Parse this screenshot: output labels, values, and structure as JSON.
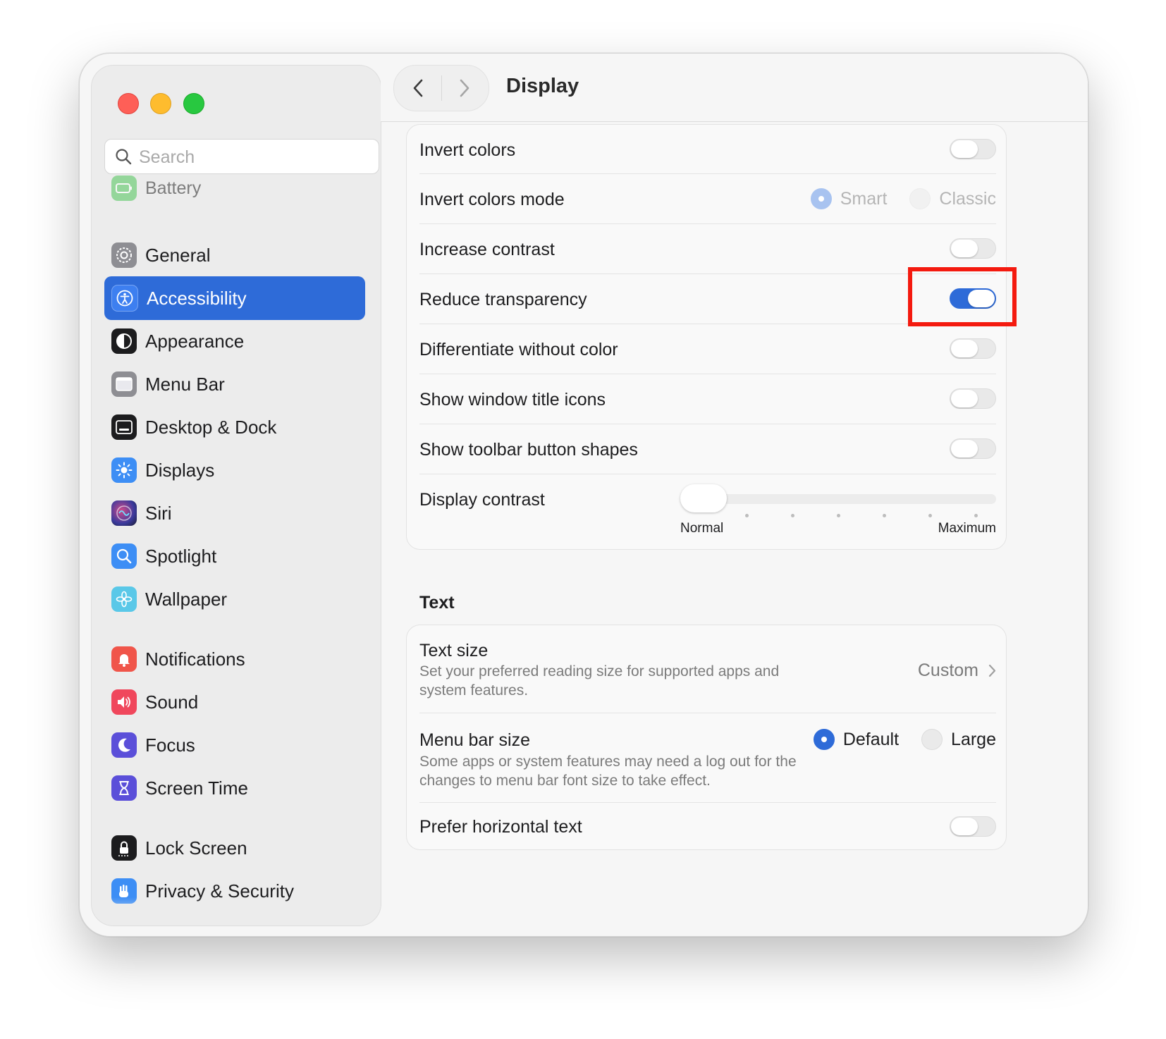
{
  "window": {
    "title": "Display"
  },
  "sidebar": {
    "search_placeholder": "Search",
    "partial_top": "Battery",
    "items": [
      {
        "label": "General",
        "icon": "gear-icon",
        "color": "#8e8e93"
      },
      {
        "label": "Accessibility",
        "icon": "accessibility-icon",
        "color": "#2e6bd8",
        "active": true
      },
      {
        "label": "Appearance",
        "icon": "appearance-icon",
        "color": "#1c1c1e"
      },
      {
        "label": "Menu Bar",
        "icon": "menu-bar-icon",
        "color": "#8e8e93"
      },
      {
        "label": "Desktop & Dock",
        "icon": "dock-icon",
        "color": "#1c1c1e"
      },
      {
        "label": "Displays",
        "icon": "sun-icon",
        "color": "#3d8ef5"
      },
      {
        "label": "Siri",
        "icon": "siri-icon",
        "color": "#3a3a5c"
      },
      {
        "label": "Spotlight",
        "icon": "magnifier-icon",
        "color": "#3d8ef5"
      },
      {
        "label": "Wallpaper",
        "icon": "flower-icon",
        "color": "#5ac8e8"
      },
      {
        "label": "Notifications",
        "icon": "bell-icon",
        "color": "#f0554a"
      },
      {
        "label": "Sound",
        "icon": "speaker-icon",
        "color": "#f0475c"
      },
      {
        "label": "Focus",
        "icon": "moon-icon",
        "color": "#5b4fd9"
      },
      {
        "label": "Screen Time",
        "icon": "hourglass-icon",
        "color": "#5b4fd9"
      },
      {
        "label": "Lock Screen",
        "icon": "lock-icon",
        "color": "#1c1c1e"
      }
    ],
    "partial_bottom": "Privacy & Security"
  },
  "display_settings": {
    "invert_colors": {
      "label": "Invert colors",
      "on": false
    },
    "invert_colors_mode": {
      "label": "Invert colors mode",
      "options": [
        "Smart",
        "Classic"
      ],
      "selected": "Smart",
      "disabled": true
    },
    "increase_contrast": {
      "label": "Increase contrast",
      "on": false
    },
    "reduce_transparency": {
      "label": "Reduce transparency",
      "on": true
    },
    "differentiate_without_color": {
      "label": "Differentiate without color",
      "on": false
    },
    "show_window_title_icons": {
      "label": "Show window title icons",
      "on": false
    },
    "show_toolbar_button_shapes": {
      "label": "Show toolbar button shapes",
      "on": false
    },
    "display_contrast": {
      "label": "Display contrast",
      "min_label": "Normal",
      "max_label": "Maximum",
      "value": 0
    }
  },
  "text_section": {
    "title": "Text",
    "text_size": {
      "label": "Text size",
      "description": "Set your preferred reading size for supported apps and system features.",
      "value": "Custom"
    },
    "menu_bar_size": {
      "label": "Menu bar size",
      "description": "Some apps or system features may need a log out for the changes to menu bar font size to take effect.",
      "options": [
        "Default",
        "Large"
      ],
      "selected": "Default"
    },
    "prefer_horizontal_text": {
      "label": "Prefer horizontal text",
      "on": false
    }
  },
  "colors": {
    "accent": "#2e6bd8",
    "highlight": "#f41a0f"
  }
}
